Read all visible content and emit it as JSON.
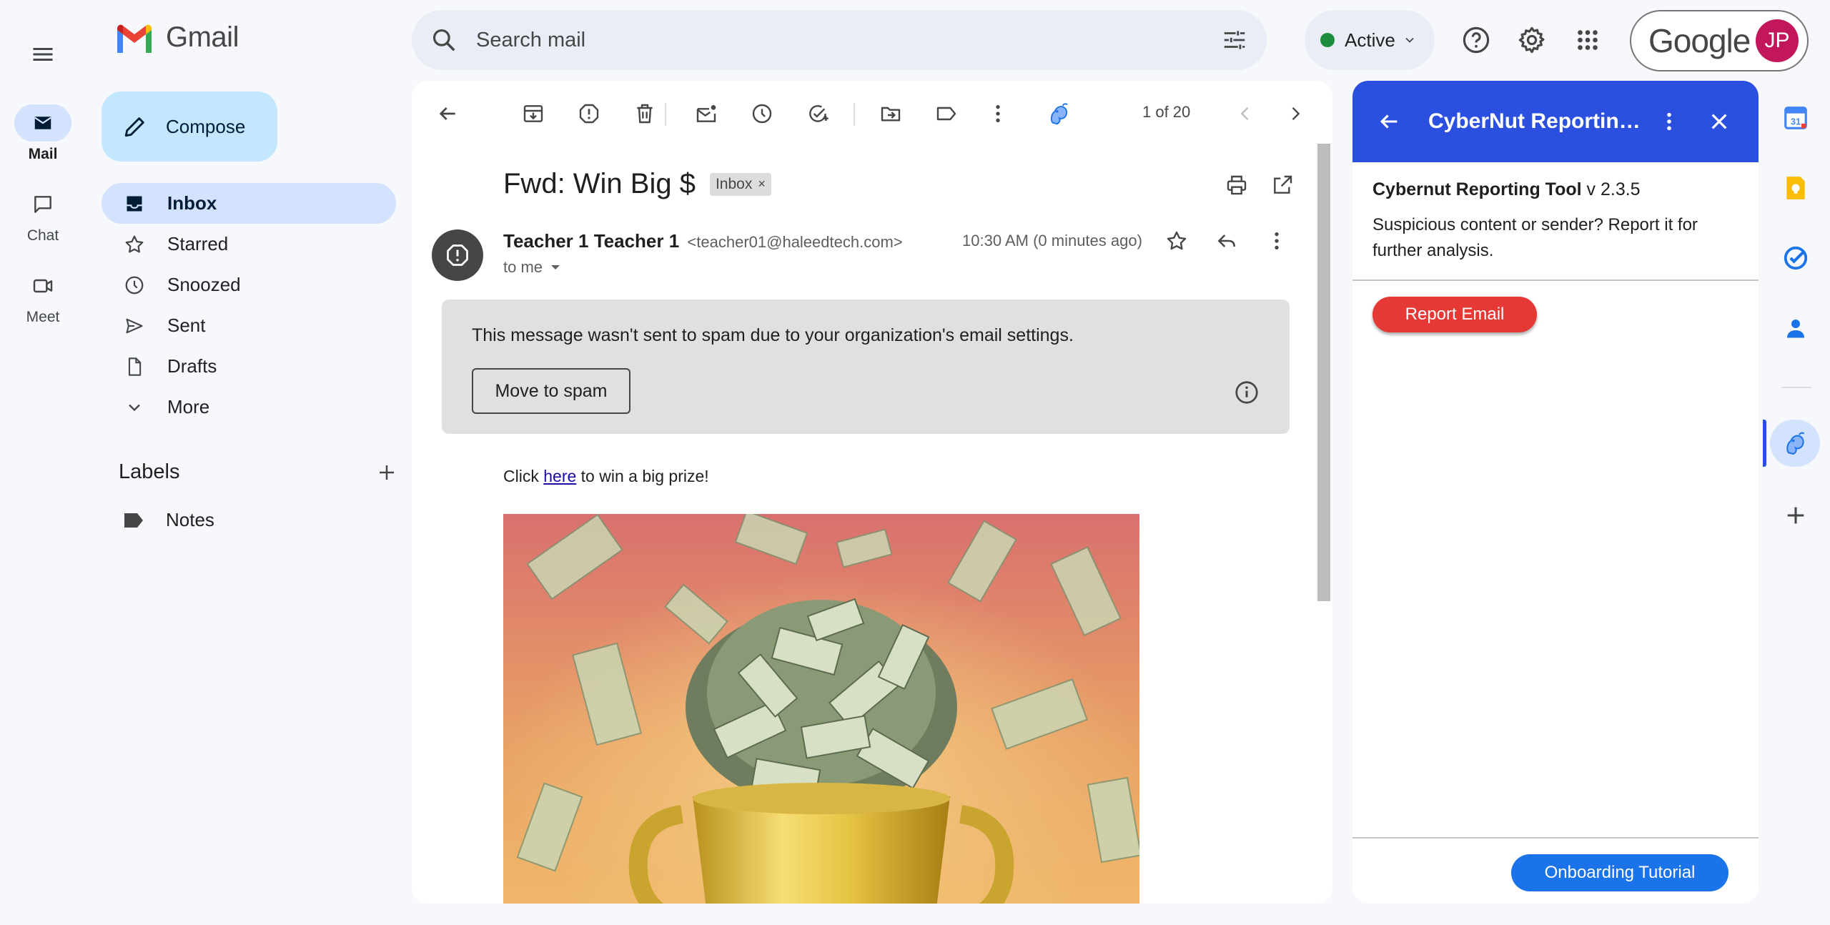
{
  "rail": {
    "items": [
      {
        "label": "Mail"
      },
      {
        "label": "Chat"
      },
      {
        "label": "Meet"
      }
    ]
  },
  "nav": {
    "logo_text": "Gmail",
    "compose_label": "Compose",
    "items": [
      {
        "label": "Inbox",
        "icon": "inbox-icon"
      },
      {
        "label": "Starred",
        "icon": "star-icon"
      },
      {
        "label": "Snoozed",
        "icon": "clock-icon"
      },
      {
        "label": "Sent",
        "icon": "send-icon"
      },
      {
        "label": "Drafts",
        "icon": "draft-icon"
      },
      {
        "label": "More",
        "icon": "chevron-down-icon"
      }
    ],
    "labels_title": "Labels",
    "labels": [
      {
        "label": "Notes"
      }
    ]
  },
  "topbar": {
    "search_placeholder": "Search mail",
    "status_label": "Active",
    "account_brand": "Google",
    "avatar_initials": "JP"
  },
  "toolbar": {
    "page_count": "1 of 20"
  },
  "email": {
    "subject": "Fwd: Win Big $",
    "label_chip": "Inbox",
    "chip_close": "×",
    "sender_name": "Teacher 1 Teacher 1",
    "sender_email": "<teacher01@haleedtech.com>",
    "recipient": "to me",
    "timestamp": "10:30 AM (0 minutes ago)",
    "warning_text": "This message wasn't sent to spam due to your organization's email settings.",
    "move_to_spam": "Move to spam",
    "body_before": "Click ",
    "body_link": "here",
    "body_after": " to win a big prize!"
  },
  "panel": {
    "title": "CyberNut Reporting Tool",
    "tool_name": "Cybernut Reporting Tool",
    "tool_version": " v 2.3.5",
    "description": "Suspicious content or sender? Report it for further analysis.",
    "report_button": "Report Email",
    "tutorial_button": "Onboarding Tutorial"
  },
  "colors": {
    "accent": "#2b50e0",
    "compose_bg": "#c2e7ff",
    "active_nav": "#d3e3fd",
    "report_red": "#e53935",
    "tutorial_blue": "#1a73e8",
    "status_green": "#1e8e3e"
  }
}
